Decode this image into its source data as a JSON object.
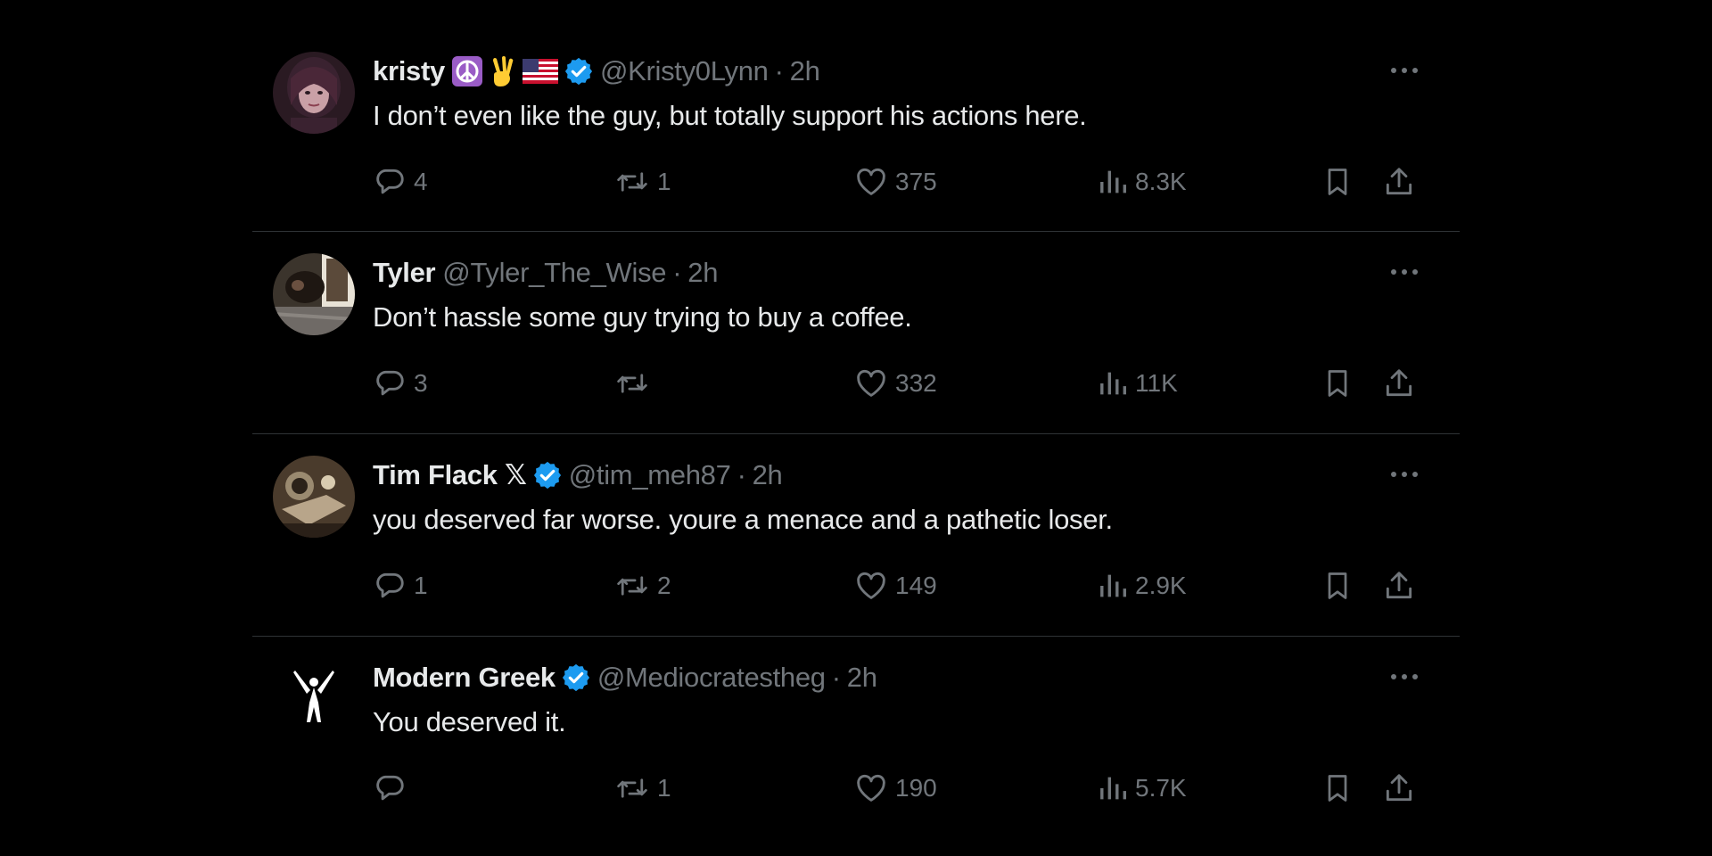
{
  "posts": [
    {
      "name": "kristy",
      "badges": [
        "peace-symbol",
        "victory-hand",
        "us-flag",
        "verified"
      ],
      "handle": "@Kristy0Lynn",
      "time": "2h",
      "text": "I don’t even like the guy, but totally support his actions here.",
      "replies": "4",
      "reposts": "1",
      "likes": "375",
      "views": "8.3K"
    },
    {
      "name": "Tyler",
      "badges": [],
      "handle": "@Tyler_The_Wise",
      "time": "2h",
      "text": "Don’t hassle some guy trying to buy a coffee.",
      "replies": "3",
      "reposts": "",
      "likes": "332",
      "views": "11K"
    },
    {
      "name": "Tim Flack 𝕏",
      "badges": [
        "verified"
      ],
      "handle": "@tim_meh87",
      "time": "2h",
      "text": "you deserved far worse. youre a menace and a pathetic loser.",
      "replies": "1",
      "reposts": "2",
      "likes": "149",
      "views": "2.9K"
    },
    {
      "name": "Modern Greek",
      "badges": [
        "verified"
      ],
      "handle": "@Mediocratestheg",
      "time": "2h",
      "text": "You deserved it.",
      "replies": "",
      "reposts": "1",
      "likes": "190",
      "views": "5.7K"
    }
  ],
  "separator": "·",
  "colors": {
    "background": "#000000",
    "text": "#e7e9ea",
    "muted": "#71767b",
    "divider": "#2f3336",
    "verified": "#1d9bf0"
  },
  "icons": [
    "reply-icon",
    "repost-icon",
    "like-icon",
    "views-icon",
    "bookmark-icon",
    "share-icon",
    "more-icon"
  ]
}
